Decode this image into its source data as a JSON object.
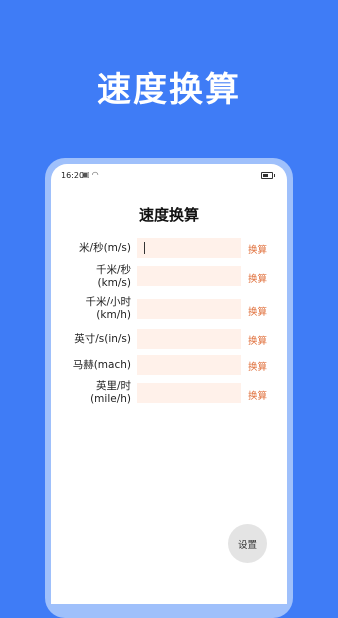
{
  "headline": "速度换算",
  "status_bar": {
    "time": "16:20"
  },
  "app": {
    "title": "速度换算",
    "rows": [
      {
        "label": "米/秒(m/s)",
        "value": "",
        "button": "换算"
      },
      {
        "label": "千米/秒\n(km/s)",
        "value": "",
        "button": "换算"
      },
      {
        "label": "千米/小时\n(km/h)",
        "value": "",
        "button": "换算"
      },
      {
        "label": "英寸/s(in/s)",
        "value": "",
        "button": "换算"
      },
      {
        "label": "马赫(mach)",
        "value": "",
        "button": "换算"
      },
      {
        "label": "英里/时\n(mile/h)",
        "value": "",
        "button": "换算"
      }
    ],
    "settings_label": "设置"
  },
  "colors": {
    "background": "#3f7cf6",
    "field": "#fff1ea",
    "convert_text": "#e0703c"
  }
}
